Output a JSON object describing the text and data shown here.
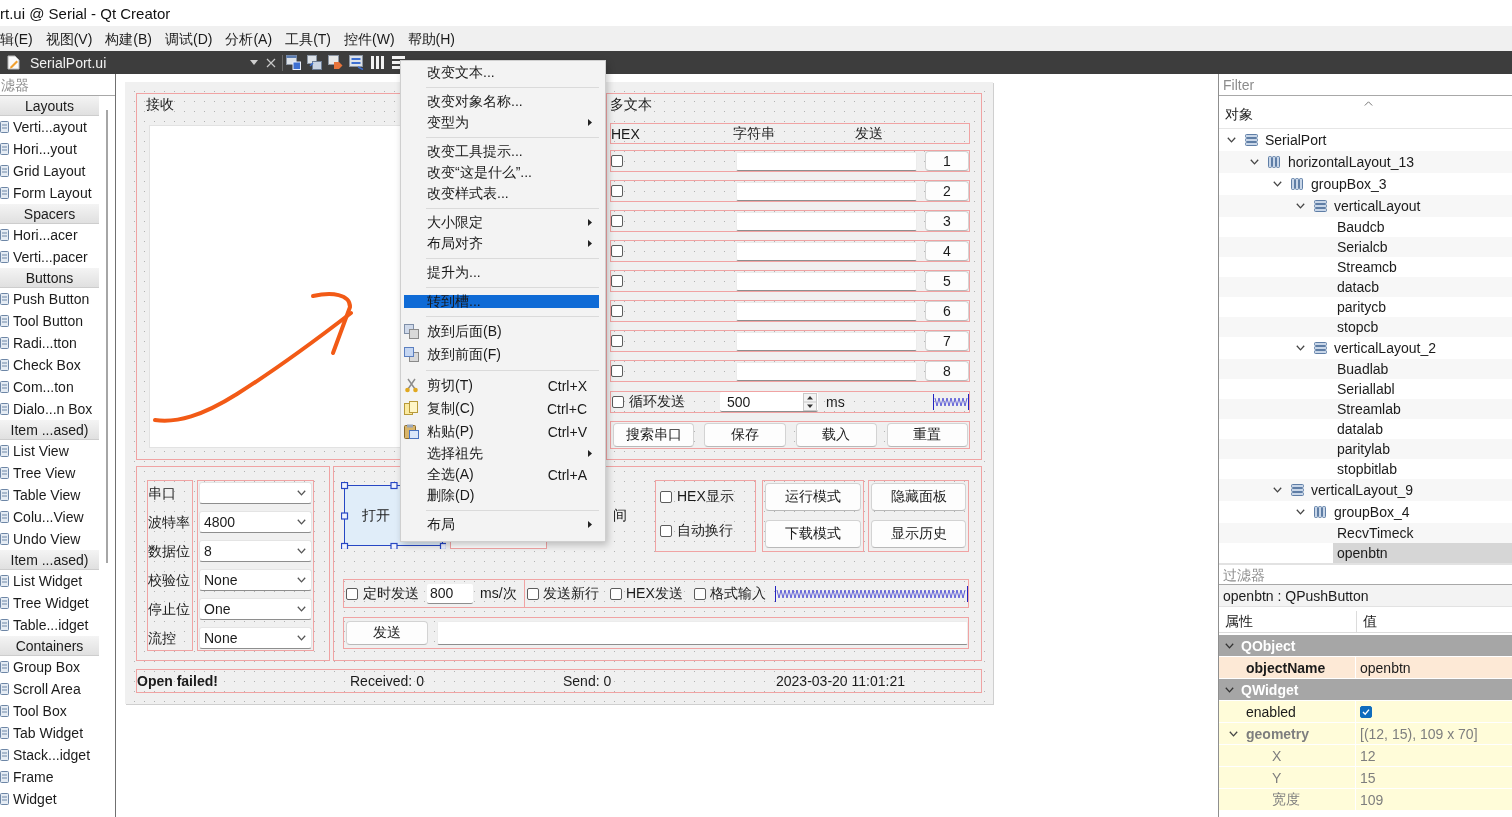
{
  "window": {
    "title": "rt.ui @ Serial - Qt Creator"
  },
  "menu_bar": [
    "辑(E)",
    "视图(V)",
    "构建(B)",
    "调试(D)",
    "分析(A)",
    "工具(T)",
    "控件(W)",
    "帮助(H)"
  ],
  "editor_tab": {
    "title": "SerialPort.ui"
  },
  "widget_box": {
    "filter_placeholder": "滤器",
    "sections": [
      {
        "title": "Layouts",
        "items": [
          "Verti...ayout",
          "Hori...yout",
          "Grid Layout",
          "Form Layout"
        ]
      },
      {
        "title": "Spacers",
        "items": [
          "Hori...acer",
          "Verti...pacer"
        ]
      },
      {
        "title": "Buttons",
        "items": [
          "Push Button",
          "Tool Button",
          "Radi...tton",
          "Check Box",
          "Com...ton",
          "Dialo...n Box"
        ]
      },
      {
        "title": "Item ...ased)",
        "items": [
          "List View",
          "Tree View",
          "Table View",
          "Colu...View",
          "Undo View"
        ]
      },
      {
        "title": "Item ...ased)",
        "items": [
          "List Widget",
          "Tree Widget",
          "Table...idget"
        ]
      },
      {
        "title": "Containers",
        "items": [
          "Group Box",
          "Scroll Area",
          "Tool Box",
          "Tab Widget",
          "Stack...idget",
          "Frame",
          "Widget"
        ]
      }
    ]
  },
  "form": {
    "receive_group": {
      "title": "接收"
    },
    "multi_text_group": {
      "title": "多文本",
      "header": [
        "HEX",
        "字符串",
        "发送"
      ],
      "rows": [
        {
          "hex": false,
          "button": "1"
        },
        {
          "hex": false,
          "button": "2"
        },
        {
          "hex": false,
          "button": "3"
        },
        {
          "hex": false,
          "button": "4"
        },
        {
          "hex": false,
          "button": "5"
        },
        {
          "hex": false,
          "button": "6"
        },
        {
          "hex": false,
          "button": "7"
        },
        {
          "hex": false,
          "button": "8"
        }
      ],
      "loop": {
        "checked": false,
        "label": "循环发送",
        "value": "500",
        "unit": "ms"
      },
      "buttons": [
        "搜索串口",
        "保存",
        "载入",
        "重置"
      ]
    },
    "port_settings": [
      {
        "label": "串口"
      },
      {
        "label": "波特率",
        "value": "4800"
      },
      {
        "label": "数据位",
        "value": "8"
      },
      {
        "label": "校验位",
        "value": "None"
      },
      {
        "label": "停止位",
        "value": "One"
      },
      {
        "label": "流控",
        "value": "None"
      }
    ],
    "controls": {
      "open_button": {
        "label": "打开",
        "selected": true
      },
      "time_label": "间",
      "display_options": [
        {
          "label": "HEX显示",
          "checked": false
        },
        {
          "label": "自动换行",
          "checked": false
        }
      ],
      "mode_buttons": [
        "运行模式",
        "下载模式"
      ],
      "panel_buttons": [
        "隐藏面板",
        "显示历史"
      ],
      "timer": {
        "checked": false,
        "label": "定时发送",
        "value": "800",
        "unit": "ms/次"
      },
      "send_options": [
        {
          "label": "发送新行",
          "checked": false
        },
        {
          "label": "HEX发送",
          "checked": false
        },
        {
          "label": "格式输入",
          "checked": false
        }
      ],
      "send_button": "发送"
    },
    "status": [
      {
        "kind": "message",
        "text": "Open failed!"
      },
      {
        "kind": "counter",
        "text": "Received: 0"
      },
      {
        "kind": "counter",
        "text": "Send: 0"
      },
      {
        "kind": "time",
        "text": "2023-03-20 11:01:21"
      }
    ]
  },
  "context_menu": {
    "sections": [
      {
        "items": [
          {
            "kind": "plain",
            "label": "改变文本...",
            "submenu": false,
            "selected": false
          }
        ]
      },
      {
        "items": [
          {
            "kind": "plain",
            "label": "改变对象名称...",
            "submenu": false,
            "selected": false
          },
          {
            "kind": "plain",
            "label": "变型为",
            "submenu": true,
            "selected": false
          }
        ]
      },
      {
        "items": [
          {
            "kind": "plain",
            "label": "改变工具提示...",
            "submenu": false,
            "selected": false
          },
          {
            "kind": "plain",
            "label": "改变“这是什么”...",
            "submenu": false,
            "selected": false
          },
          {
            "kind": "plain",
            "label": "改变样式表...",
            "submenu": false,
            "selected": false
          }
        ]
      },
      {
        "items": [
          {
            "kind": "plain",
            "label": "大小限定",
            "submenu": true,
            "selected": false
          },
          {
            "kind": "plain",
            "label": "布局对齐",
            "submenu": true,
            "selected": false
          }
        ]
      },
      {
        "items": [
          {
            "kind": "plain",
            "label": "提升为...",
            "submenu": false,
            "selected": false
          }
        ]
      },
      {
        "items": [
          {
            "kind": "plain",
            "label": "转到槽...",
            "submenu": false,
            "selected": true
          }
        ]
      },
      {
        "items": [
          {
            "kind": "lower",
            "label": "放到后面(B)",
            "submenu": false,
            "selected": false
          },
          {
            "kind": "raise",
            "label": "放到前面(F)",
            "submenu": false,
            "selected": false
          }
        ]
      },
      {
        "items": [
          {
            "kind": "cut",
            "label": "剪切(T)",
            "shortcut": "Ctrl+X",
            "submenu": false,
            "selected": false
          },
          {
            "kind": "copy",
            "label": "复制(C)",
            "shortcut": "Ctrl+C",
            "submenu": false,
            "selected": false
          },
          {
            "kind": "paste",
            "label": "粘贴(P)",
            "shortcut": "Ctrl+V",
            "submenu": false,
            "selected": false
          },
          {
            "kind": "plain",
            "label": "选择祖先",
            "submenu": true,
            "selected": false
          },
          {
            "kind": "plain",
            "label": "全选(A)",
            "shortcut": "Ctrl+A",
            "submenu": false,
            "selected": false
          },
          {
            "kind": "plain",
            "label": "删除(D)",
            "submenu": false,
            "selected": false
          }
        ]
      },
      {
        "items": [
          {
            "kind": "plain",
            "label": "布局",
            "submenu": true,
            "selected": false
          }
        ]
      }
    ]
  },
  "object_inspector": {
    "filter_placeholder": "Filter",
    "header": "对象",
    "tree": [
      {
        "name": "SerialPort",
        "kind": "vbox",
        "expanded": true,
        "selected": false,
        "children": [
          {
            "name": "horizontalLayout_13",
            "kind": "hbox",
            "expanded": true,
            "selected": false,
            "children": [
              {
                "name": "groupBox_3",
                "kind": "hbox",
                "expanded": true,
                "selected": false,
                "children": [
                  {
                    "name": "verticalLayout",
                    "kind": "vbox",
                    "expanded": true,
                    "selected": false,
                    "children": [
                      {
                        "name": "Baudcb",
                        "selected": false
                      },
                      {
                        "name": "Serialcb",
                        "selected": false
                      },
                      {
                        "name": "Streamcb",
                        "selected": false
                      },
                      {
                        "name": "datacb",
                        "selected": false
                      },
                      {
                        "name": "paritycb",
                        "selected": false
                      },
                      {
                        "name": "stopcb",
                        "selected": false
                      }
                    ]
                  },
                  {
                    "name": "verticalLayout_2",
                    "kind": "vbox",
                    "expanded": true,
                    "selected": false,
                    "children": [
                      {
                        "name": "Buadlab",
                        "selected": false
                      },
                      {
                        "name": "Seriallabl",
                        "selected": false
                      },
                      {
                        "name": "Streamlab",
                        "selected": false
                      },
                      {
                        "name": "datalab",
                        "selected": false
                      },
                      {
                        "name": "paritylab",
                        "selected": false
                      },
                      {
                        "name": "stopbitlab",
                        "selected": false
                      }
                    ]
                  }
                ]
              },
              {
                "name": "verticalLayout_9",
                "kind": "vbox",
                "expanded": true,
                "selected": false,
                "children": [
                  {
                    "name": "groupBox_4",
                    "kind": "hbox",
                    "expanded": true,
                    "selected": false,
                    "children": [
                      {
                        "name": "RecvTimeck",
                        "selected": false
                      },
                      {
                        "name": "openbtn",
                        "selected": true
                      }
                    ]
                  }
                ]
              }
            ]
          }
        ]
      }
    ]
  },
  "property_editor": {
    "filter_placeholder": "过滤器",
    "object_label": "openbtn : QPushButton",
    "columns": [
      "属性",
      "值"
    ],
    "groups": [
      {
        "name": "QObject",
        "expanded": true,
        "color": "#fde9d6",
        "properties": [
          {
            "kind": "text",
            "name": "objectName",
            "value": "openbtn",
            "modified": true,
            "disabled": false
          }
        ]
      },
      {
        "name": "QWidget",
        "expanded": true,
        "color": "#fffcd9",
        "properties": [
          {
            "kind": "check",
            "name": "enabled",
            "checked": true,
            "modified": false,
            "disabled": false
          },
          {
            "kind": "text",
            "name": "geometry",
            "value": "[(12, 15), 109 x 70]",
            "modified": true,
            "disabled": true,
            "expanded": true,
            "children": [
              {
                "kind": "text",
                "name": "X",
                "value": "12",
                "modified": false,
                "disabled": true
              },
              {
                "kind": "text",
                "name": "Y",
                "value": "15",
                "modified": false,
                "disabled": true
              },
              {
                "kind": "text",
                "name": "宽度",
                "value": "109",
                "modified": false,
                "disabled": true
              }
            ]
          }
        ]
      }
    ]
  }
}
